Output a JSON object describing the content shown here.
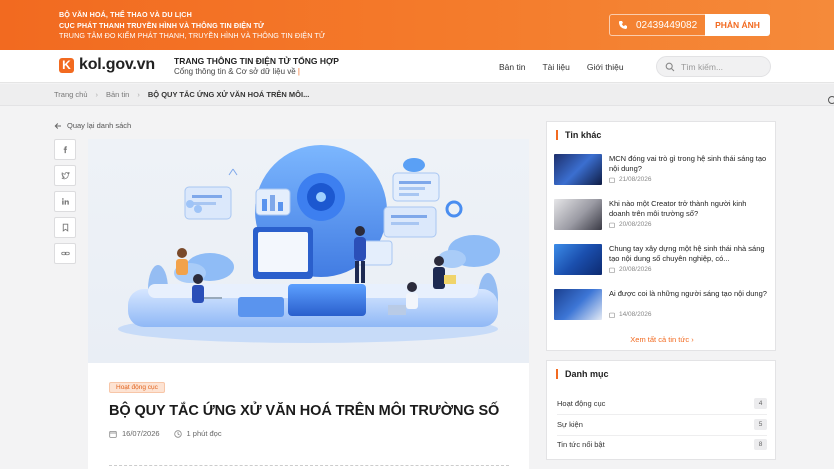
{
  "topbar": {
    "org_line1": "BỘ VĂN HOÁ, THỂ THAO VÀ DU LỊCH",
    "org_line2": "CỤC PHÁT THANH TRUYỀN HÌNH VÀ THÔNG TIN ĐIỆN TỬ",
    "org_line3": "TRUNG TÂM ĐO KIỂM PHÁT THANH, TRUYỀN HÌNH VÀ THÔNG TIN ĐIỆN TỬ",
    "phone": "02439449082",
    "report_label": "PHẢN ÁNH"
  },
  "header": {
    "logo_letter": "K",
    "logo_text": "kol.gov.vn",
    "site_title": "TRANG THÔNG TIN ĐIỆN TỬ TỔNG HỢP",
    "site_subtitle": "Cổng thông tin & Cơ sở dữ liệu về",
    "nav": [
      "Bản tin",
      "Tài liệu",
      "Giới thiệu"
    ],
    "search_placeholder": "Tìm kiếm..."
  },
  "breadcrumb": {
    "home": "Trang chủ",
    "section": "Bản tin",
    "current": "BỘ QUY TẮC ỨNG XỬ VĂN HOÁ TRÊN MÔI..."
  },
  "back_label": "Quay lại danh sách",
  "share_icons": [
    "facebook-icon",
    "twitter-icon",
    "linkedin-icon",
    "bookmark-icon",
    "link-icon"
  ],
  "article": {
    "tag": "Hoạt động cục",
    "title": "BỘ QUY TẮC ỨNG XỬ VĂN HOÁ TRÊN MÔI TRƯỜNG SỐ",
    "date": "16/07/2026",
    "read_time": "1 phút đọc"
  },
  "related": {
    "title": "Tin khác",
    "items": [
      {
        "title": "MCN đóng vai trò gì trong hệ sinh thái sáng tạo nội dung?",
        "date": "21/08/2026"
      },
      {
        "title": "Khi nào một Creator trở thành người kinh doanh trên môi trường số?",
        "date": "20/08/2026"
      },
      {
        "title": "Chung tay xây dựng một hệ sinh thái nhà sáng tạo nội dung số chuyên nghiệp, có...",
        "date": "20/08/2026"
      },
      {
        "title": "Ai được coi là những người sáng tạo nội dung?",
        "date": "14/08/2026"
      }
    ],
    "see_all": "Xem tất cả tin tức"
  },
  "categories": {
    "title": "Danh mục",
    "items": [
      {
        "label": "Hoạt động cục",
        "count": "4"
      },
      {
        "label": "Sự kiện",
        "count": "5"
      },
      {
        "label": "Tin tức nổi bật",
        "count": "8"
      }
    ]
  },
  "colors": {
    "accent": "#f26a20",
    "hero_blue": "#4a8ef0"
  }
}
